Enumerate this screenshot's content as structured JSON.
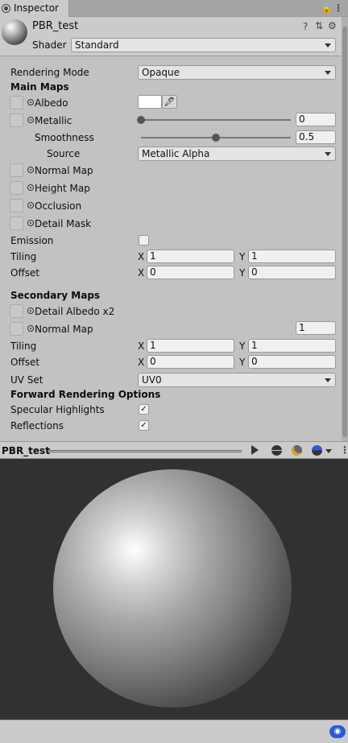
{
  "tab": {
    "title": "Inspector"
  },
  "header": {
    "name": "PBR_test",
    "shader_label": "Shader",
    "shader_value": "Standard"
  },
  "properties": {
    "rendering_mode_label": "Rendering Mode",
    "rendering_mode_value": "Opaque",
    "main_maps": "Main Maps",
    "albedo": "Albedo",
    "metallic": "Metallic",
    "metallic_value": "0",
    "metallic_slider": 0,
    "smoothness": "Smoothness",
    "smoothness_value": "0.5",
    "smoothness_slider": 0.5,
    "source": "Source",
    "source_value": "Metallic Alpha",
    "normal_map": "Normal Map",
    "height_map": "Height Map",
    "occlusion": "Occlusion",
    "detail_mask": "Detail Mask",
    "emission": "Emission",
    "emission_checked": false,
    "tiling": "Tiling",
    "tiling_x": "1",
    "tiling_y": "1",
    "offset": "Offset",
    "offset_x": "0",
    "offset_y": "0",
    "x": "X",
    "y": "Y",
    "secondary_maps": "Secondary Maps",
    "detail_albedo": "Detail Albedo x2",
    "normal_map_2": "Normal Map",
    "normal_map_2_value": "1",
    "tiling2_x": "1",
    "tiling2_y": "1",
    "offset2_x": "0",
    "offset2_y": "0",
    "uv_set": "UV Set",
    "uv_set_value": "UV0",
    "forward_options": "Forward Rendering Options",
    "specular": "Specular Highlights",
    "specular_checked": true,
    "reflections": "Reflections",
    "reflections_checked": true
  },
  "preview": {
    "title": "PBR_test"
  },
  "colors": {
    "albedo": "#ffffff",
    "preview_bg": "#313131"
  }
}
